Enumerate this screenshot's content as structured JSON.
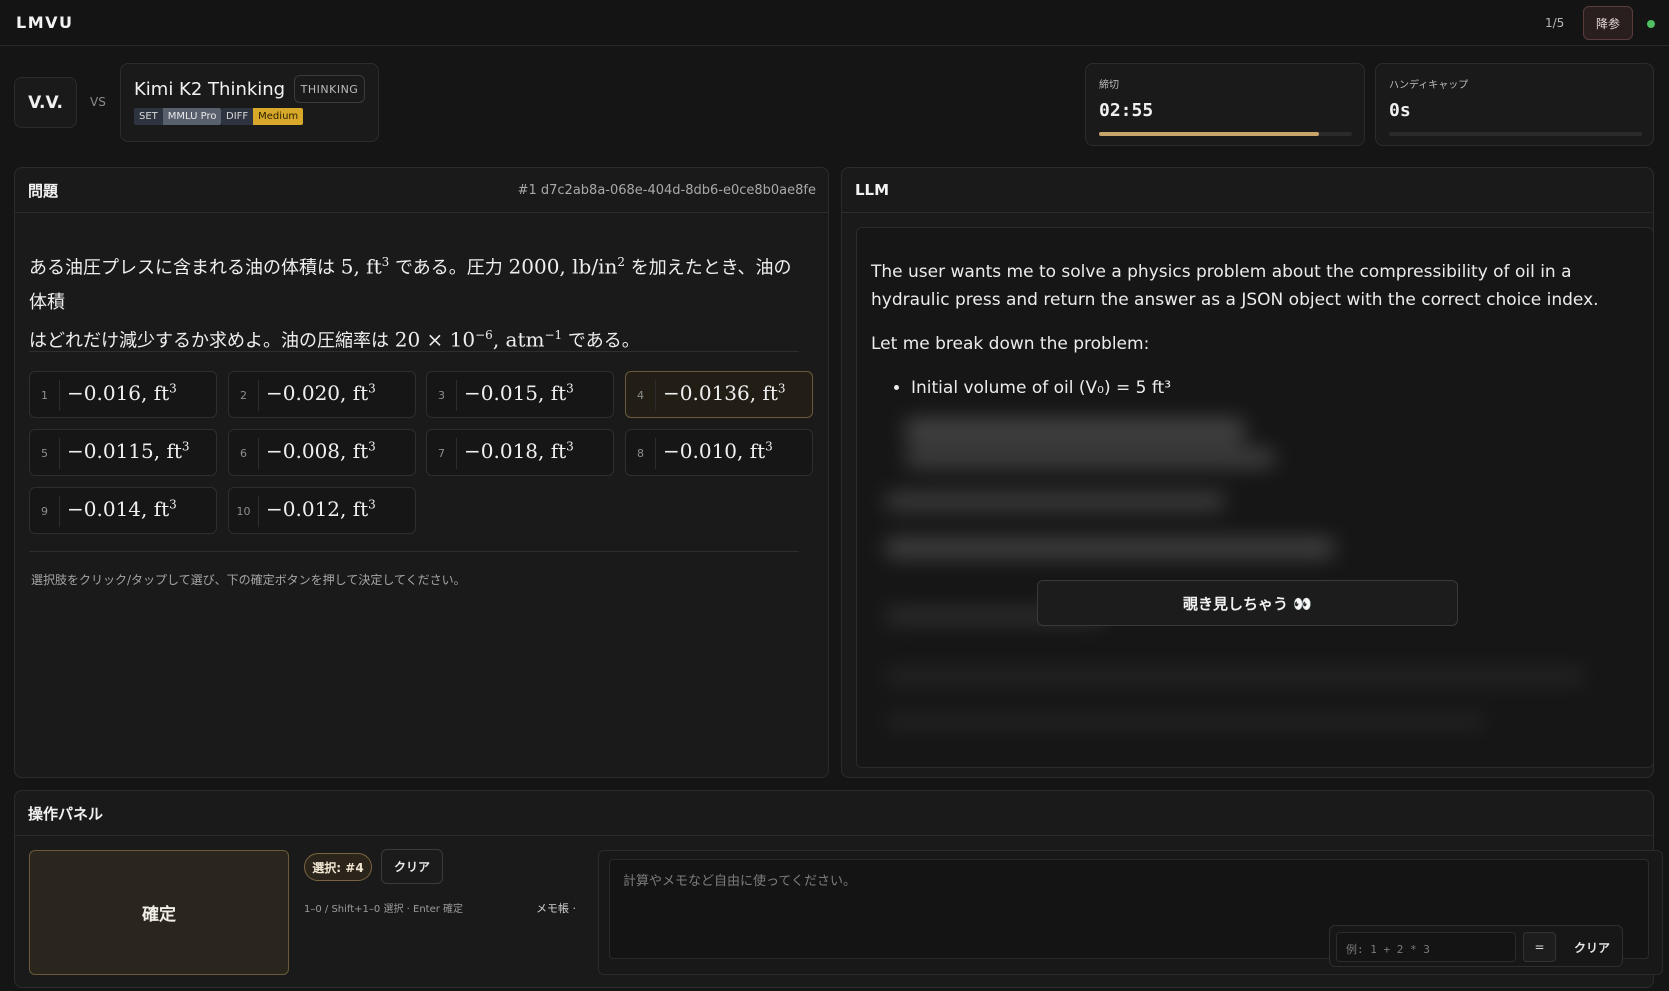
{
  "app": {
    "logo": "LMVU",
    "progress": "1/5",
    "surrender_label": "降参",
    "status_color": "#4fbf5f"
  },
  "match": {
    "player": "V.V.",
    "vs": "VS",
    "opponent": {
      "name": "Kimi K2 Thinking",
      "badge": "THINKING",
      "set_key": "SET",
      "set_value": "MMLU Pro",
      "diff_key": "DIFF",
      "diff_value": "Medium"
    }
  },
  "stats": {
    "deadline": {
      "label": "締切",
      "value": "02:55",
      "progress": 0.87
    },
    "handicap": {
      "label": "ハンディキャップ",
      "value": "0s",
      "progress": 0
    }
  },
  "question": {
    "heading": "問題",
    "id": "#1 d7c2ab8a-068e-404d-8db6-e0ce8b0ae8fe",
    "text_line1_a": "ある油圧プレスに含まれる油の体積は ",
    "text_line1_b": "5, ft",
    "text_line1_c": " である。圧力 ",
    "text_line1_d": "2000, lb/in",
    "text_line1_e": " を加えたとき、油の体積",
    "text_line2_a": "はどれだけ減少するか求めよ。油の圧縮率は ",
    "text_line2_b": "20 × 10",
    "text_line2_c": ", atm",
    "text_line2_d": " である。",
    "sup_3": "3",
    "sup_2": "2",
    "sup_neg6": "−6",
    "sup_neg1": "−1",
    "choices": [
      {
        "num": "1",
        "text": "−0.016, ft",
        "sup": "3"
      },
      {
        "num": "2",
        "text": "−0.020, ft",
        "sup": "3"
      },
      {
        "num": "3",
        "text": "−0.015, ft",
        "sup": "3"
      },
      {
        "num": "4",
        "text": "−0.0136, ft",
        "sup": "3"
      },
      {
        "num": "5",
        "text": "−0.0115, ft",
        "sup": "3"
      },
      {
        "num": "6",
        "text": "−0.008, ft",
        "sup": "3"
      },
      {
        "num": "7",
        "text": "−0.018, ft",
        "sup": "3"
      },
      {
        "num": "8",
        "text": "−0.010, ft",
        "sup": "3"
      },
      {
        "num": "9",
        "text": "−0.014, ft",
        "sup": "3"
      },
      {
        "num": "10",
        "text": "−0.012, ft",
        "sup": "3"
      }
    ],
    "selected_choice": "4",
    "hint": "選択肢をクリック/タップして選び、下の確定ボタンを押して決定してください。"
  },
  "llm": {
    "heading": "LLM",
    "para1": "The user wants me to solve a physics problem about the compressibility of oil in a hydraulic press and return the answer as a JSON object with the correct choice index.",
    "para2": "Let me break down the problem:",
    "bullet1": "Initial volume of oil (V₀) = 5 ft³",
    "peek_label": "覗き見しちゃう 👀"
  },
  "controls": {
    "heading": "操作パネル",
    "confirm_label": "確定",
    "selection_label": "選択: #4",
    "clear_label": "クリア",
    "key_hint": "1–0 / Shift+1–0 選択 · Enter 確定",
    "memo_label": "メモ帳 ·",
    "memo_placeholder": "計算やメモなど自由に使ってください。",
    "calc_placeholder": "例: 1 + 2 * 3",
    "calc_equals": "=",
    "calc_clear": "クリア"
  }
}
